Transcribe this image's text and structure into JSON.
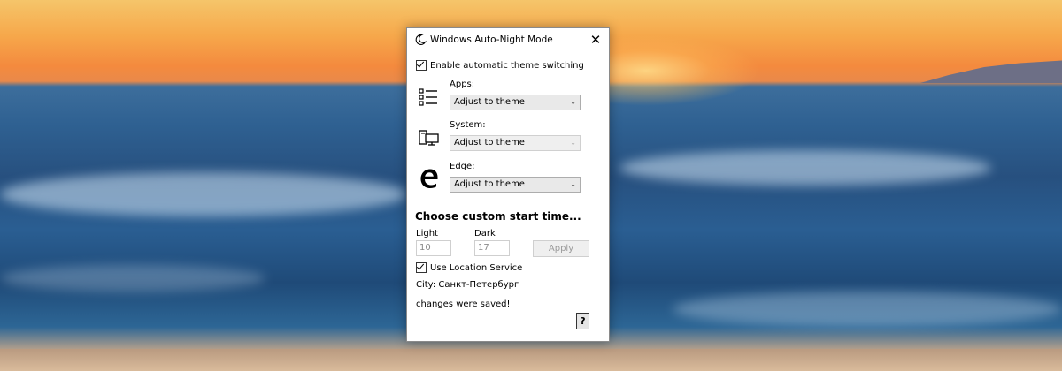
{
  "window": {
    "title": "Windows Auto-Night Mode",
    "close_glyph": "✕",
    "icon": "moon-icon"
  },
  "enable_switch": {
    "label": "Enable automatic theme switching",
    "checked": true
  },
  "apps": {
    "label": "Apps:",
    "value": "Adjust to theme",
    "icon": "list-icon",
    "enabled": true
  },
  "system": {
    "label": "System:",
    "value": "Adjust to theme",
    "icon": "computer-icon",
    "enabled": false
  },
  "edge": {
    "label": "Edge:",
    "value": "Adjust to theme",
    "icon": "edge-icon",
    "enabled": true
  },
  "custom_time": {
    "heading": "Choose custom start time...",
    "light_label": "Light",
    "light_value": "10",
    "dark_label": "Dark",
    "dark_value": "17",
    "apply_label": "Apply"
  },
  "location": {
    "label": "Use Location Service",
    "checked": true,
    "city_text": "City: Санкт-Петербург"
  },
  "status": {
    "message": "changes were saved!"
  },
  "help": {
    "label": "?"
  }
}
